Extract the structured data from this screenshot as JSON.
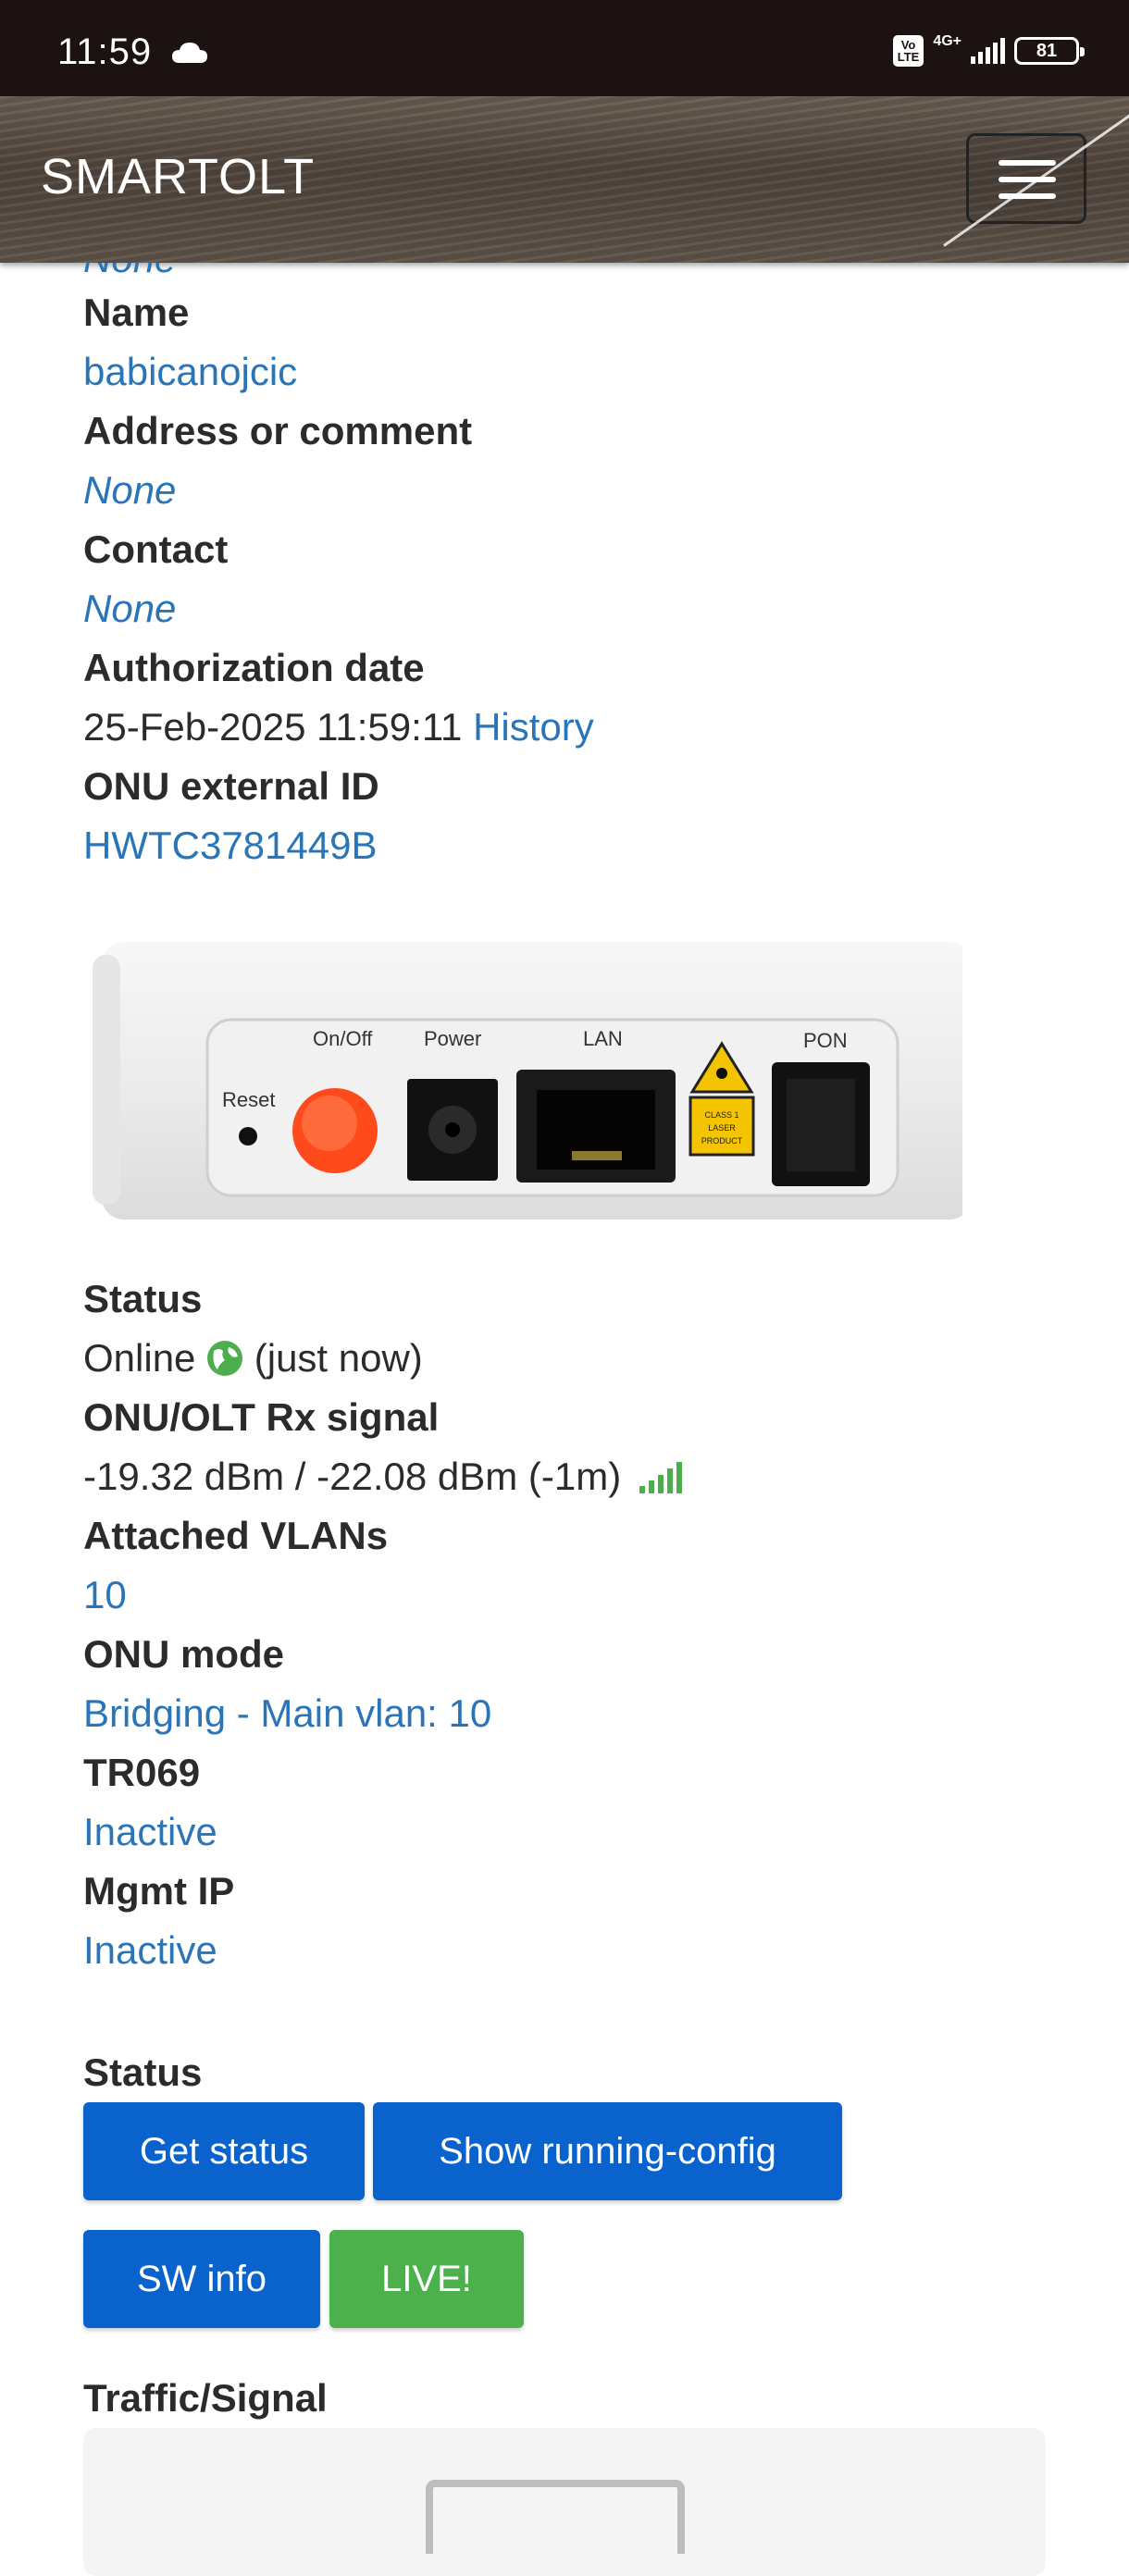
{
  "status_bar": {
    "time": "11:59",
    "volte_label": "Vo\nLTE",
    "network": "4G+",
    "battery": "81"
  },
  "navbar": {
    "brand": "SMARTOLT"
  },
  "details": {
    "partial_top": "None",
    "name_label": "Name",
    "name_value": "babicanojcic",
    "address_label": "Address or comment",
    "address_value": "None",
    "contact_label": "Contact",
    "contact_value": "None",
    "auth_label": "Authorization date",
    "auth_value": "25-Feb-2025 11:59:11",
    "history_link": "History",
    "ext_id_label": "ONU external ID",
    "ext_id_value": "HWTC3781449B"
  },
  "device": {
    "labels": {
      "reset": "Reset",
      "onoff": "On/Off",
      "power": "Power",
      "lan": "LAN",
      "pon": "PON",
      "laser": "CLASS 1 LASER PRODUCT"
    }
  },
  "status_info": {
    "status_label": "Status",
    "status_value": "Online",
    "status_time": "(just now)",
    "signal_label": "ONU/OLT Rx signal",
    "signal_value": "-19.32 dBm / -22.08 dBm (-1m)",
    "vlans_label": "Attached VLANs",
    "vlans_value": "10",
    "mode_label": "ONU mode",
    "mode_value": "Bridging - Main vlan: 10",
    "tr069_label": "TR069",
    "tr069_value": "Inactive",
    "mgmt_label": "Mgmt IP",
    "mgmt_value": "Inactive"
  },
  "actions": {
    "section_label": "Status",
    "get_status": "Get status",
    "running_config": "Show running-config",
    "sw_info": "SW info",
    "live": "LIVE!"
  },
  "traffic": {
    "section_label": "Traffic/Signal"
  },
  "colors": {
    "link": "#2a74b8",
    "primary_button": "#0a63cc",
    "success_button": "#4cb14c",
    "online_globe": "#4cae4c"
  }
}
